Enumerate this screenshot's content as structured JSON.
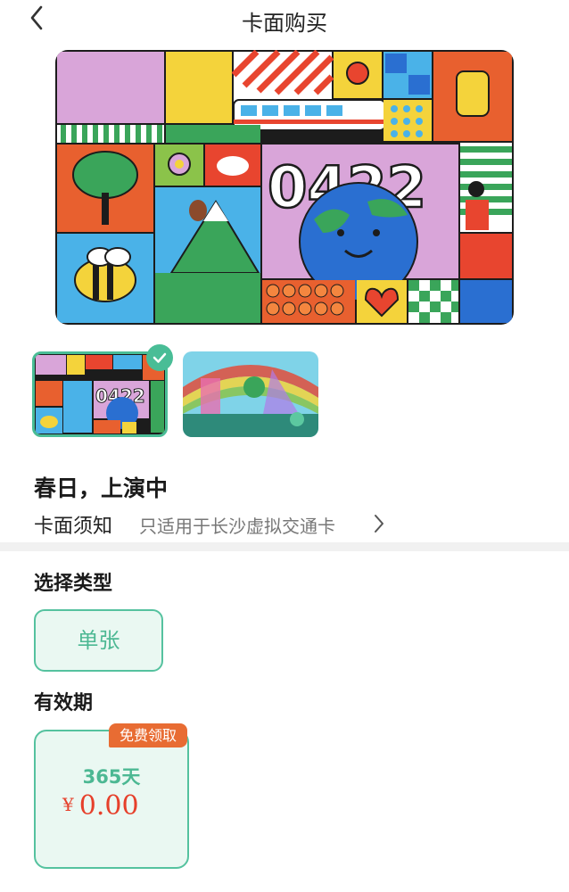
{
  "header": {
    "title": "卡面购买",
    "back_icon": "chevron-left-icon"
  },
  "card": {
    "name": "春日，上演中",
    "artwork_text": "0422",
    "notice_label": "卡面须知",
    "notice_value": "只适用于长沙虚拟交通卡",
    "notice_icon": "chevron-right-icon"
  },
  "thumbnails": [
    {
      "name": "0422 colorful grid card",
      "selected": true
    },
    {
      "name": "rainbow scenery card",
      "selected": false
    }
  ],
  "type_section": {
    "title": "选择类型",
    "options": [
      {
        "label": "单张",
        "selected": true
      }
    ]
  },
  "validity_section": {
    "title": "有效期",
    "options": [
      {
        "badge": "免费领取",
        "duration": "365天",
        "currency": "¥",
        "price": "0.00",
        "selected": true
      }
    ]
  },
  "colors": {
    "accent": "#49bd96",
    "accent_bg": "#eaf8f2",
    "badge": "#e86c33",
    "price": "#e6402b"
  }
}
